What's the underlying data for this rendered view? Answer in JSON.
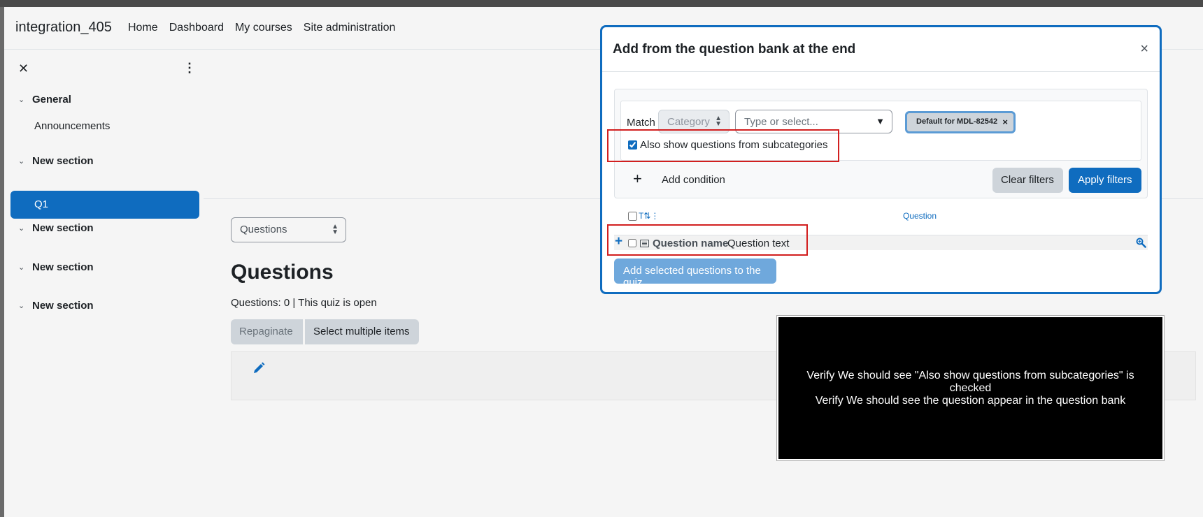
{
  "navbar": {
    "brand": "integration_405",
    "links": [
      "Home",
      "Dashboard",
      "My courses",
      "Site administration"
    ]
  },
  "drawer": {
    "close_glyph": "✕",
    "menu_glyph": "⋮",
    "sections": [
      {
        "label": "General",
        "items": [
          "Announcements"
        ]
      },
      {
        "label": "New section",
        "items": [
          "Q1"
        ]
      },
      {
        "label": "New section",
        "items": []
      },
      {
        "label": "New section",
        "items": []
      },
      {
        "label": "New section",
        "items": []
      }
    ],
    "active_item": "Q1"
  },
  "main": {
    "select_value": "Questions",
    "title": "Questions",
    "subtitle": "Questions: 0 | This quiz is open",
    "repaginate_label": "Repaginate",
    "select_multiple_label": "Select multiple items"
  },
  "modal": {
    "title": "Add from the question bank at the end",
    "close_glyph": "×",
    "filter": {
      "match_label": "Match",
      "category_value": "Category",
      "type_placeholder": "Type or select...",
      "chip_label": "Default for MDL-82542",
      "chip_remove": "×",
      "subcategories_label": "Also show questions from subcategories",
      "subcategories_checked": true,
      "add_condition_glyph": "+",
      "add_condition_label": "Add condition",
      "clear_label": "Clear filters",
      "apply_label": "Apply filters"
    },
    "table": {
      "sort_label": "T",
      "question_col": "Question",
      "row": {
        "add_glyph": "+",
        "name_label": "Question name",
        "text_label": "Question text"
      }
    },
    "add_selected_label": "Add selected questions to the quiz"
  },
  "overlay": {
    "line1": "Verify We should see \"Also show questions from subcategories\" is checked",
    "line2": "Verify We should see the question appear in the question bank"
  },
  "colors": {
    "primary": "#0f6cbf",
    "highlight": "#d21f1f",
    "secondary_button": "#ced4da"
  }
}
